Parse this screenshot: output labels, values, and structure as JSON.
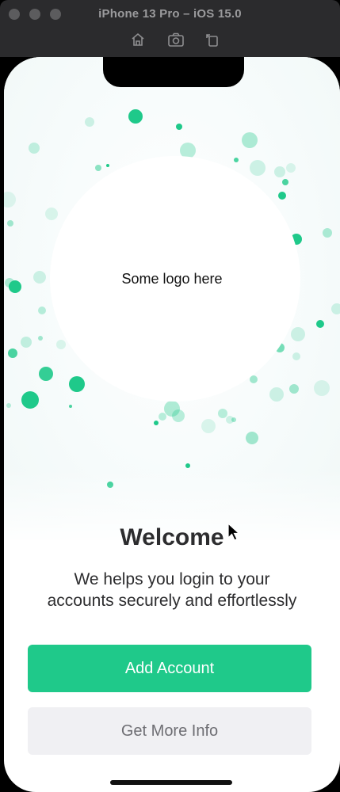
{
  "window": {
    "title": "iPhone 13 Pro – iOS 15.0",
    "toolbar_icons": [
      "home-icon",
      "screenshot-icon",
      "rotate-icon"
    ]
  },
  "hero": {
    "logo_placeholder": "Some logo here",
    "accent_color": "#1fc98a"
  },
  "content": {
    "title": "Welcome",
    "subtitle_line1": "We helps you login to your",
    "subtitle_line2": "accounts securely and effortlessly"
  },
  "buttons": {
    "primary_label": "Add Account",
    "secondary_label": "Get More Info"
  }
}
